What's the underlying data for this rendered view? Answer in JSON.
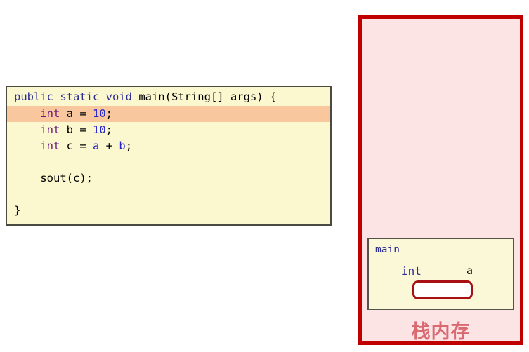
{
  "code_editor": {
    "lines": [
      {
        "id": "line-1",
        "highlighted": false,
        "tokens": [
          {
            "text": "public static void ",
            "kind": "kw"
          },
          {
            "text": "main(String[] args) {",
            "kind": "plain"
          }
        ]
      },
      {
        "id": "line-2",
        "highlighted": true,
        "tokens": [
          {
            "text": "    ",
            "kind": "plain"
          },
          {
            "text": "int",
            "kind": "type"
          },
          {
            "text": " a = ",
            "kind": "plain"
          },
          {
            "text": "10",
            "kind": "num"
          },
          {
            "text": ";",
            "kind": "plain"
          }
        ]
      },
      {
        "id": "line-3",
        "highlighted": false,
        "tokens": [
          {
            "text": "    ",
            "kind": "plain"
          },
          {
            "text": "int",
            "kind": "type"
          },
          {
            "text": " b = ",
            "kind": "plain"
          },
          {
            "text": "10",
            "kind": "num"
          },
          {
            "text": ";",
            "kind": "plain"
          }
        ]
      },
      {
        "id": "line-4",
        "highlighted": false,
        "tokens": [
          {
            "text": "    ",
            "kind": "plain"
          },
          {
            "text": "int",
            "kind": "type"
          },
          {
            "text": " c = ",
            "kind": "plain"
          },
          {
            "text": "a",
            "kind": "var"
          },
          {
            "text": " + ",
            "kind": "plain"
          },
          {
            "text": "b",
            "kind": "var"
          },
          {
            "text": ";",
            "kind": "plain"
          }
        ]
      },
      {
        "id": "line-5",
        "highlighted": false,
        "tokens": [
          {
            "text": "",
            "kind": "plain"
          }
        ]
      },
      {
        "id": "line-6",
        "highlighted": false,
        "tokens": [
          {
            "text": "    sout(c);",
            "kind": "plain"
          }
        ]
      },
      {
        "id": "line-7",
        "highlighted": false,
        "tokens": [
          {
            "text": "",
            "kind": "plain"
          }
        ]
      },
      {
        "id": "line-8",
        "highlighted": false,
        "tokens": [
          {
            "text": "}",
            "kind": "plain"
          }
        ]
      }
    ],
    "plain_text": "public static void main(String[] args) {\n    int a = 10;\n    int b = 10;\n    int c = a + b;\n\n    sout(c);\n\n}"
  },
  "stack_panel": {
    "label": "栈内存",
    "frame": {
      "name": "main",
      "variable": {
        "type": "int",
        "name": "a",
        "value": ""
      }
    }
  },
  "colors": {
    "panel_border": "#C00000",
    "panel_fill": "#FCE3E4",
    "frame_fill": "#FBF8D8",
    "frame_border": "#55524C",
    "value_box_border": "#A81014",
    "code_fill": "#FBF8D0",
    "code_border": "#4B4A42",
    "highlight_line": "#F9C79D",
    "keyword": "#2D2D91",
    "type": "#6A1B7A",
    "number": "#2222CC",
    "stack_label": "#D96A72"
  }
}
